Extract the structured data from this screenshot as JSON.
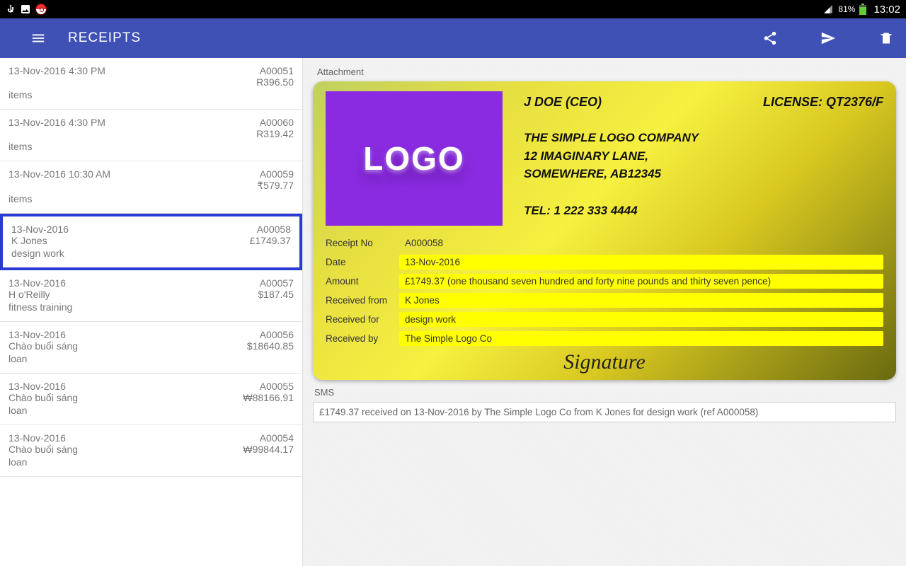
{
  "statusbar": {
    "battery": "81%",
    "time": "13:02"
  },
  "appbar": {
    "title": "RECEIPTS"
  },
  "sidebar": {
    "items": [
      {
        "date": "13-Nov-2016  4:30 PM",
        "code": "A00051",
        "line2": "",
        "amount": "R396.50",
        "line3": "items",
        "selected": false
      },
      {
        "date": "13-Nov-2016  4:30 PM",
        "code": "A00060",
        "line2": "",
        "amount": "R319.42",
        "line3": "items",
        "selected": false
      },
      {
        "date": "13-Nov-2016  10:30 AM",
        "code": "A00059",
        "line2": "",
        "amount": "₹579.77",
        "line3": "items",
        "selected": false
      },
      {
        "date": "13-Nov-2016",
        "code": "A00058",
        "line2": "K Jones",
        "amount": "£1749.37",
        "line3": "design work",
        "selected": true
      },
      {
        "date": "13-Nov-2016",
        "code": "A00057",
        "line2": "H o'Reilly",
        "amount": "$187.45",
        "line3": "fitness training",
        "selected": false
      },
      {
        "date": "13-Nov-2016",
        "code": "A00056",
        "line2": "Chào buổi sáng",
        "amount": "$18640.85",
        "line3": "loan",
        "selected": false
      },
      {
        "date": "13-Nov-2016",
        "code": "A00055",
        "line2": "Chào buổi sáng",
        "amount": "₩88166.91",
        "line3": "loan",
        "selected": false
      },
      {
        "date": "13-Nov-2016",
        "code": "A00054",
        "line2": "Chào buổi sáng",
        "amount": "₩99844.17",
        "line3": "loan",
        "selected": false
      }
    ]
  },
  "detail": {
    "attachment_label": "Attachment",
    "logo_text": "LOGO",
    "ceo": "J DOE (CEO)",
    "license": "LICENSE: QT2376/F",
    "company_name": "THE SIMPLE LOGO COMPANY",
    "address1": "12 IMAGINARY LANE,",
    "address2": " SOMEWHERE,  AB12345",
    "tel": "TEL: 1 222 333 4444",
    "fields": {
      "receipt_no_label": "Receipt No",
      "receipt_no": "A000058",
      "date_label": "Date",
      "date": "13-Nov-2016",
      "amount_label": "Amount",
      "amount": "£1749.37 (one thousand seven hundred and forty nine pounds and thirty seven pence)",
      "received_from_label": "Received from",
      "received_from": "K Jones",
      "received_for_label": "Received for",
      "received_for": "design work",
      "received_by_label": "Received by",
      "received_by": "The Simple Logo Co"
    },
    "signature": "Signature",
    "sms_label": "SMS",
    "sms_text": "£1749.37 received on 13-Nov-2016 by The Simple Logo Co from K Jones for design work (ref A000058)"
  }
}
